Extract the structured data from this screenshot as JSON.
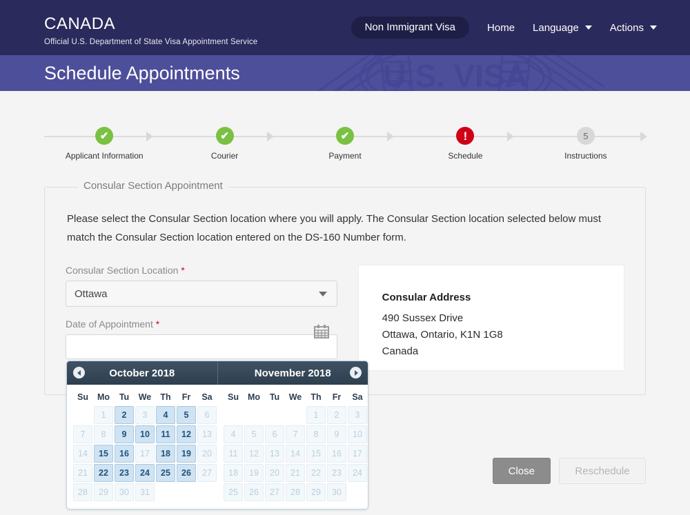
{
  "header": {
    "brand_title": "Canada",
    "brand_subtitle": "Official U.S. Department of State Visa Appointment Service",
    "nav": {
      "pill_label": "Non Immigrant Visa",
      "home_label": "Home",
      "language_label": "Language",
      "actions_label": "Actions"
    }
  },
  "banner": {
    "title": "Schedule Appointments",
    "watermark_text": "U.S. VISA"
  },
  "stepper": {
    "steps": [
      {
        "label": "Applicant Information",
        "state": "done",
        "glyph": "✔"
      },
      {
        "label": "Courier",
        "state": "done",
        "glyph": "✔"
      },
      {
        "label": "Payment",
        "state": "done",
        "glyph": "✔"
      },
      {
        "label": "Schedule",
        "state": "alert",
        "glyph": "!"
      },
      {
        "label": "Instructions",
        "state": "pending",
        "glyph": "5"
      }
    ]
  },
  "panel": {
    "legend": "Consular Section Appointment",
    "intro": "Please select the Consular Section location where you will apply. The Consular Section location selected below must match the Consular Section location entered on the DS-160 Number form.",
    "location": {
      "label": "Consular Section Location",
      "required_marker": "*",
      "value": "Ottawa"
    },
    "date": {
      "label": "Date of Appointment",
      "required_marker": "*",
      "value": "",
      "placeholder": ""
    },
    "address": {
      "title": "Consular Address",
      "line1": "490 Sussex Drive",
      "line2": "Ottawa, Ontario, K1N 1G8",
      "line3": "Canada"
    }
  },
  "calendar": {
    "prev_label": "Previous month",
    "next_label": "Next month",
    "weekdays": [
      "Su",
      "Mo",
      "Tu",
      "We",
      "Th",
      "Fr",
      "Sa"
    ],
    "months": [
      {
        "title": "October 2018",
        "lead_blanks": 1,
        "weeks": [
          [
            {
              "day": "",
              "state": "blank"
            },
            {
              "day": "1",
              "state": "off"
            },
            {
              "day": "2",
              "state": "on"
            },
            {
              "day": "3",
              "state": "off"
            },
            {
              "day": "4",
              "state": "on"
            },
            {
              "day": "5",
              "state": "on"
            },
            {
              "day": "6",
              "state": "off"
            }
          ],
          [
            {
              "day": "7",
              "state": "off"
            },
            {
              "day": "8",
              "state": "off"
            },
            {
              "day": "9",
              "state": "on"
            },
            {
              "day": "10",
              "state": "on"
            },
            {
              "day": "11",
              "state": "on"
            },
            {
              "day": "12",
              "state": "on"
            },
            {
              "day": "13",
              "state": "off"
            }
          ],
          [
            {
              "day": "14",
              "state": "off"
            },
            {
              "day": "15",
              "state": "on"
            },
            {
              "day": "16",
              "state": "on"
            },
            {
              "day": "17",
              "state": "off"
            },
            {
              "day": "18",
              "state": "on"
            },
            {
              "day": "19",
              "state": "on"
            },
            {
              "day": "20",
              "state": "off"
            }
          ],
          [
            {
              "day": "21",
              "state": "off"
            },
            {
              "day": "22",
              "state": "on"
            },
            {
              "day": "23",
              "state": "on"
            },
            {
              "day": "24",
              "state": "on"
            },
            {
              "day": "25",
              "state": "on"
            },
            {
              "day": "26",
              "state": "on"
            },
            {
              "day": "27",
              "state": "off"
            }
          ],
          [
            {
              "day": "28",
              "state": "off"
            },
            {
              "day": "29",
              "state": "off"
            },
            {
              "day": "30",
              "state": "off"
            },
            {
              "day": "31",
              "state": "off"
            },
            {
              "day": "",
              "state": "blank"
            },
            {
              "day": "",
              "state": "blank"
            },
            {
              "day": "",
              "state": "blank"
            }
          ]
        ]
      },
      {
        "title": "November 2018",
        "lead_blanks": 4,
        "weeks": [
          [
            {
              "day": "",
              "state": "blank"
            },
            {
              "day": "",
              "state": "blank"
            },
            {
              "day": "",
              "state": "blank"
            },
            {
              "day": "",
              "state": "blank"
            },
            {
              "day": "1",
              "state": "off"
            },
            {
              "day": "2",
              "state": "off"
            },
            {
              "day": "3",
              "state": "off"
            }
          ],
          [
            {
              "day": "4",
              "state": "off"
            },
            {
              "day": "5",
              "state": "off"
            },
            {
              "day": "6",
              "state": "off"
            },
            {
              "day": "7",
              "state": "off"
            },
            {
              "day": "8",
              "state": "off"
            },
            {
              "day": "9",
              "state": "off"
            },
            {
              "day": "10",
              "state": "off"
            }
          ],
          [
            {
              "day": "11",
              "state": "off"
            },
            {
              "day": "12",
              "state": "off"
            },
            {
              "day": "13",
              "state": "off"
            },
            {
              "day": "14",
              "state": "off"
            },
            {
              "day": "15",
              "state": "off"
            },
            {
              "day": "16",
              "state": "off"
            },
            {
              "day": "17",
              "state": "off"
            }
          ],
          [
            {
              "day": "18",
              "state": "off"
            },
            {
              "day": "19",
              "state": "off"
            },
            {
              "day": "20",
              "state": "off"
            },
            {
              "day": "21",
              "state": "off"
            },
            {
              "day": "22",
              "state": "off"
            },
            {
              "day": "23",
              "state": "off"
            },
            {
              "day": "24",
              "state": "off"
            }
          ],
          [
            {
              "day": "25",
              "state": "off"
            },
            {
              "day": "26",
              "state": "off"
            },
            {
              "day": "27",
              "state": "off"
            },
            {
              "day": "28",
              "state": "off"
            },
            {
              "day": "29",
              "state": "off"
            },
            {
              "day": "30",
              "state": "off"
            },
            {
              "day": "",
              "state": "blank"
            }
          ]
        ]
      }
    ]
  },
  "footer": {
    "close_label": "Close",
    "reschedule_label": "Reschedule"
  },
  "colors": {
    "topbar": "#2b2a5c",
    "banner": "#4d4f9a",
    "step_done": "#7ac143",
    "step_alert": "#d10019",
    "step_pending": "#d8d8d8",
    "calendar_header": "#2e3f4e",
    "day_available": "#cfe3f2",
    "required": "#d0021b"
  }
}
